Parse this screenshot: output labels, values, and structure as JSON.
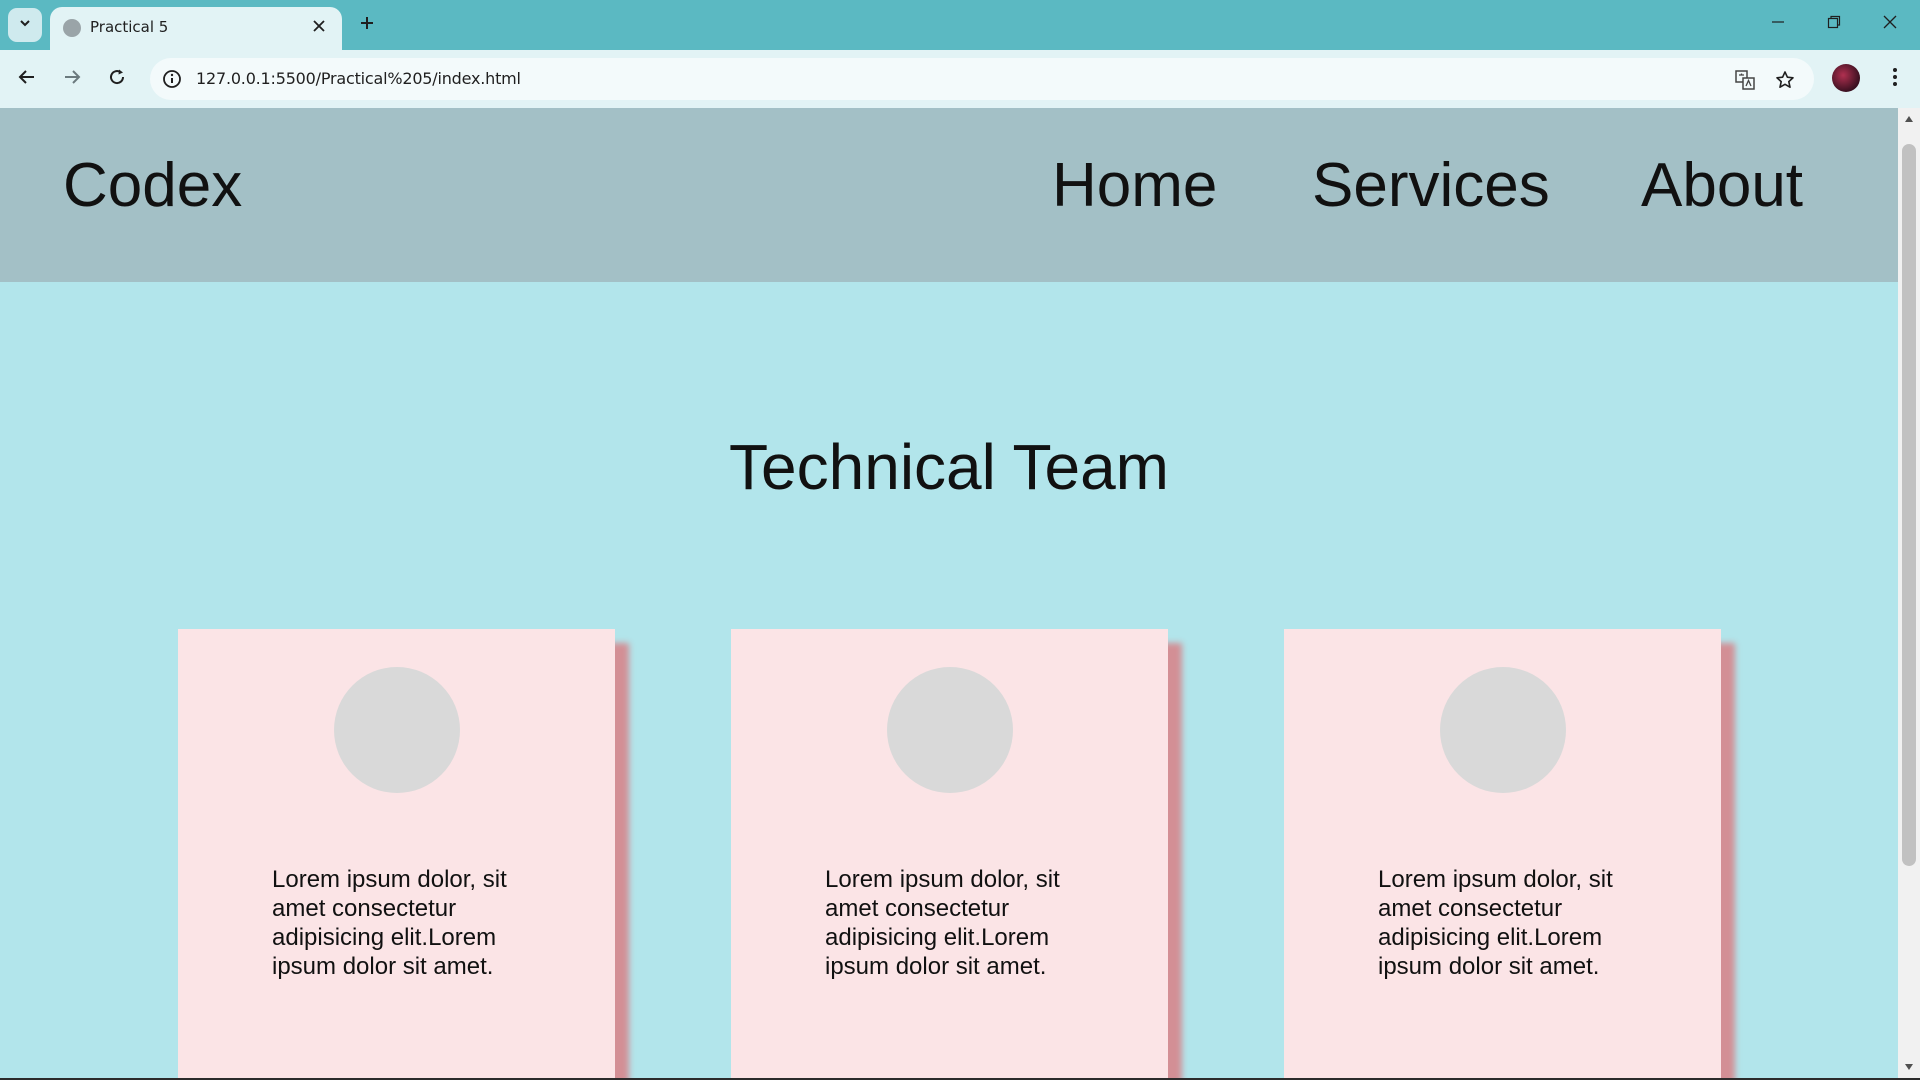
{
  "browser": {
    "tab_title": "Practical 5",
    "url": "127.0.0.1:5500/Practical%205/index.html",
    "icons": {
      "tab_search": "chevron-down-icon",
      "tab_close": "close-icon",
      "new_tab": "plus-icon",
      "back": "arrow-left-icon",
      "forward": "arrow-right-icon",
      "reload": "reload-icon",
      "site_info": "info-icon",
      "translate": "translate-icon",
      "bookmark": "star-icon",
      "menu": "kebab-menu-icon",
      "minimize": "minimize-icon",
      "restore": "restore-icon",
      "close_window": "close-icon"
    }
  },
  "site": {
    "brand": "Codex",
    "nav": [
      "Home",
      "Services",
      "About"
    ],
    "section_title": "Technical Team",
    "cards": [
      {
        "text": "Lorem ipsum dolor, sit amet consectetur adipisicing elit.Lorem ipsum dolor sit amet."
      },
      {
        "text": "Lorem ipsum dolor, sit amet consectetur adipisicing elit.Lorem ipsum dolor sit amet."
      },
      {
        "text": "Lorem ipsum dolor, sit amet consectetur adipisicing elit.Lorem ipsum dolor sit amet."
      }
    ]
  },
  "colors": {
    "chrome": "#5bb9c2",
    "header_bg": "#a3c0c6",
    "page_bg": "#b2e5eb",
    "card_bg": "#fbe4e6",
    "card_shadow": "#d38f95",
    "photo_placeholder": "#d9d9d9"
  }
}
